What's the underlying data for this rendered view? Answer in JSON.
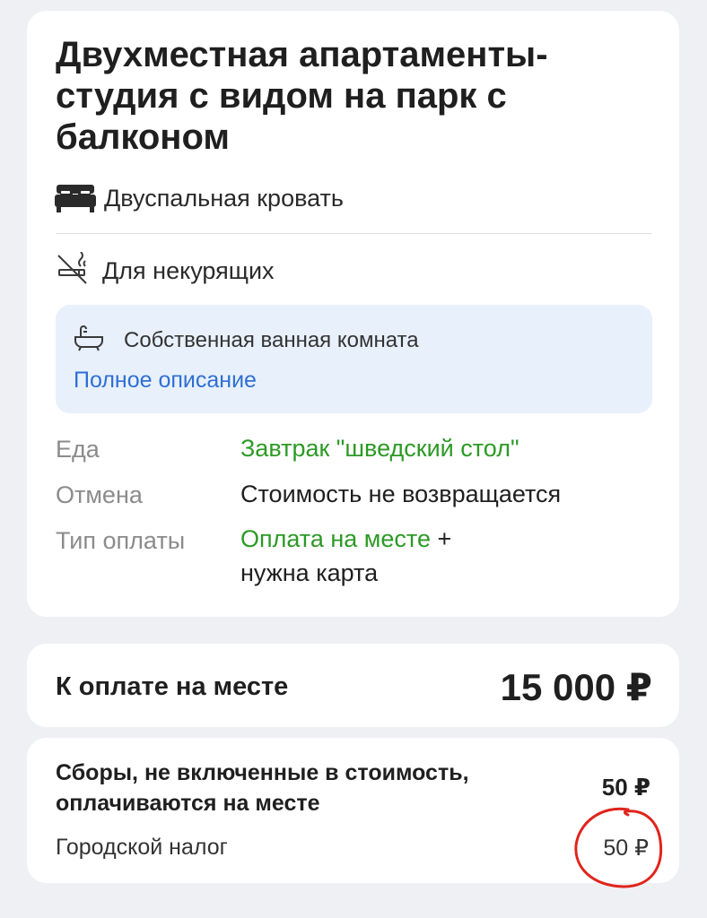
{
  "room": {
    "title": "Двухместная апартаменты-студия с видом на парк с балконом",
    "bed_icon": "double-bed-icon",
    "bed": "Двуспальная кровать",
    "smoking_icon": "no-smoking-icon",
    "smoking": "Для некурящих",
    "facilities": {
      "bath_icon": "bathtub-icon",
      "bathroom": "Собственная ванная комната",
      "link": "Полное описание"
    },
    "details": {
      "food_label": "Еда",
      "food_value": "Завтрак \"шведский стол\"",
      "cancel_label": "Отмена",
      "cancel_value": "Стоимость не возвращается",
      "payment_label": "Тип оплаты",
      "payment_value": "Оплата на месте",
      "payment_suffix": " +",
      "payment_value_2": "нужна карта"
    }
  },
  "payment": {
    "label": "К оплате на месте",
    "amount": "15 000 ₽"
  },
  "fees": {
    "title": "Сборы, не включенные в стоимость, оплачиваются на месте",
    "total": "50 ₽",
    "tax_label": "Городской налог",
    "tax_amount": "50 ₽"
  },
  "colors": {
    "background": "#eff0f4",
    "card": "#ffffff",
    "info_box": "#e8f0fc",
    "link": "#2f6fd3",
    "green": "#2c9a25",
    "annotation": "#e0241b"
  }
}
